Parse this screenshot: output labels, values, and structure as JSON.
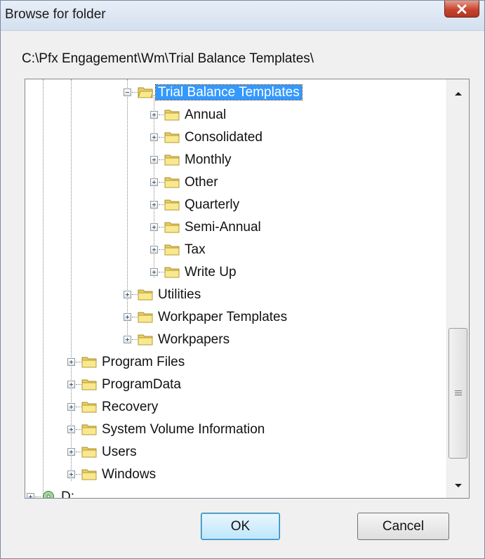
{
  "window": {
    "title": "Browse for folder",
    "close_label": "Close"
  },
  "current_path": "C:\\Pfx Engagement\\Wm\\Trial Balance Templates\\",
  "tree": [
    {
      "label": "Trial Balance Templates",
      "level": 4,
      "expander": "minus",
      "icon": "open-folder-icon",
      "selected": true
    },
    {
      "label": "Annual",
      "level": 5,
      "expander": "plus",
      "icon": "folder-icon"
    },
    {
      "label": "Consolidated",
      "level": 5,
      "expander": "plus",
      "icon": "folder-icon"
    },
    {
      "label": "Monthly",
      "level": 5,
      "expander": "plus",
      "icon": "folder-icon"
    },
    {
      "label": "Other",
      "level": 5,
      "expander": "plus",
      "icon": "folder-icon"
    },
    {
      "label": "Quarterly",
      "level": 5,
      "expander": "plus",
      "icon": "folder-icon"
    },
    {
      "label": "Semi-Annual",
      "level": 5,
      "expander": "plus",
      "icon": "folder-icon"
    },
    {
      "label": "Tax",
      "level": 5,
      "expander": "plus",
      "icon": "folder-icon"
    },
    {
      "label": "Write Up",
      "level": 5,
      "expander": "plus",
      "icon": "folder-icon"
    },
    {
      "label": "Utilities",
      "level": 4,
      "expander": "plus",
      "icon": "folder-icon"
    },
    {
      "label": "Workpaper Templates",
      "level": 4,
      "expander": "plus",
      "icon": "folder-icon"
    },
    {
      "label": "Workpapers",
      "level": 4,
      "expander": "plus",
      "icon": "folder-icon"
    },
    {
      "label": "Program Files",
      "level": 2,
      "expander": "plus",
      "icon": "folder-icon"
    },
    {
      "label": "ProgramData",
      "level": 2,
      "expander": "plus",
      "icon": "folder-icon"
    },
    {
      "label": "Recovery",
      "level": 2,
      "expander": "plus",
      "icon": "folder-icon"
    },
    {
      "label": "System Volume Information",
      "level": 2,
      "expander": "plus",
      "icon": "folder-icon"
    },
    {
      "label": "Users",
      "level": 2,
      "expander": "plus",
      "icon": "folder-icon"
    },
    {
      "label": "Windows",
      "level": 2,
      "expander": "plus",
      "icon": "folder-icon"
    },
    {
      "label": "D:",
      "level": 1,
      "expander": "plus",
      "icon": "cd-drive-icon"
    }
  ],
  "buttons": {
    "ok": "OK",
    "cancel": "Cancel"
  },
  "colors": {
    "selection": "#3399ff",
    "close_button": "#c8452f",
    "folder": "#f5e28a"
  }
}
